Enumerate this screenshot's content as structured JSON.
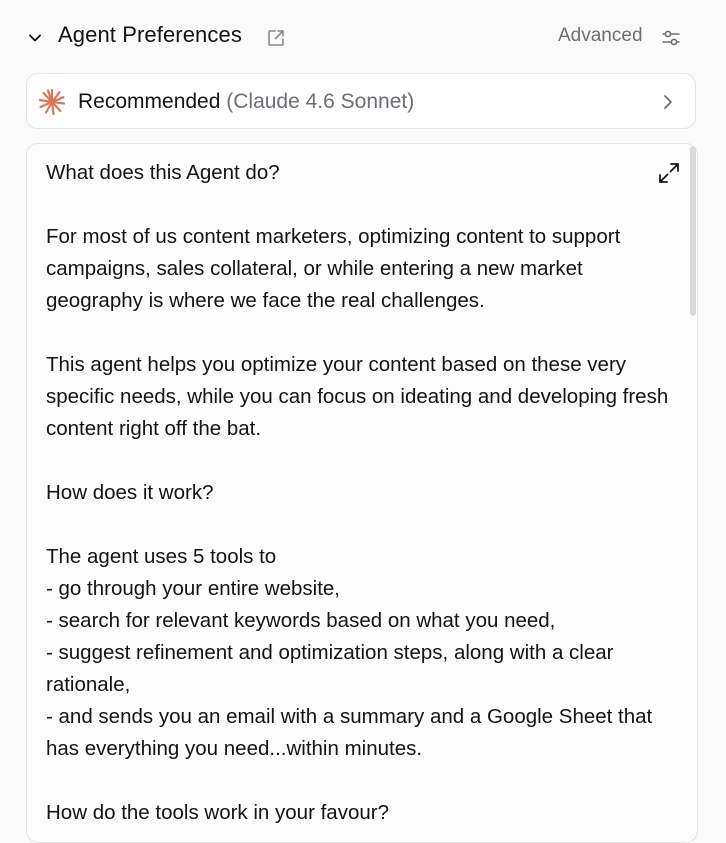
{
  "header": {
    "title": "Agent Preferences",
    "advanced_label": "Advanced"
  },
  "model": {
    "label": "Recommended",
    "sublabel": "(Claude 4.6 Sonnet)"
  },
  "description": {
    "text": "What does this Agent do?\n\nFor most of us content marketers, optimizing content to support campaigns, sales collateral, or while entering a new market geography is where we face the real challenges.\n\nThis agent helps you optimize your content based on these very specific needs, while you can focus on ideating and developing fresh content right off the bat.\n\nHow does it work?\n\nThe agent uses 5 tools to\n- go through your entire website,\n- search for relevant keywords based on what you need,\n- suggest refinement and optimization steps, along with a clear rationale,\n- and sends you an email with a summary and a Google Sheet that has everything you need...within minutes.\n\nHow do the tools work in your favour?"
  },
  "colors": {
    "text": "#141414",
    "muted": "#6d6d74",
    "border": "#e4e4e7",
    "brand": "#d97757"
  }
}
